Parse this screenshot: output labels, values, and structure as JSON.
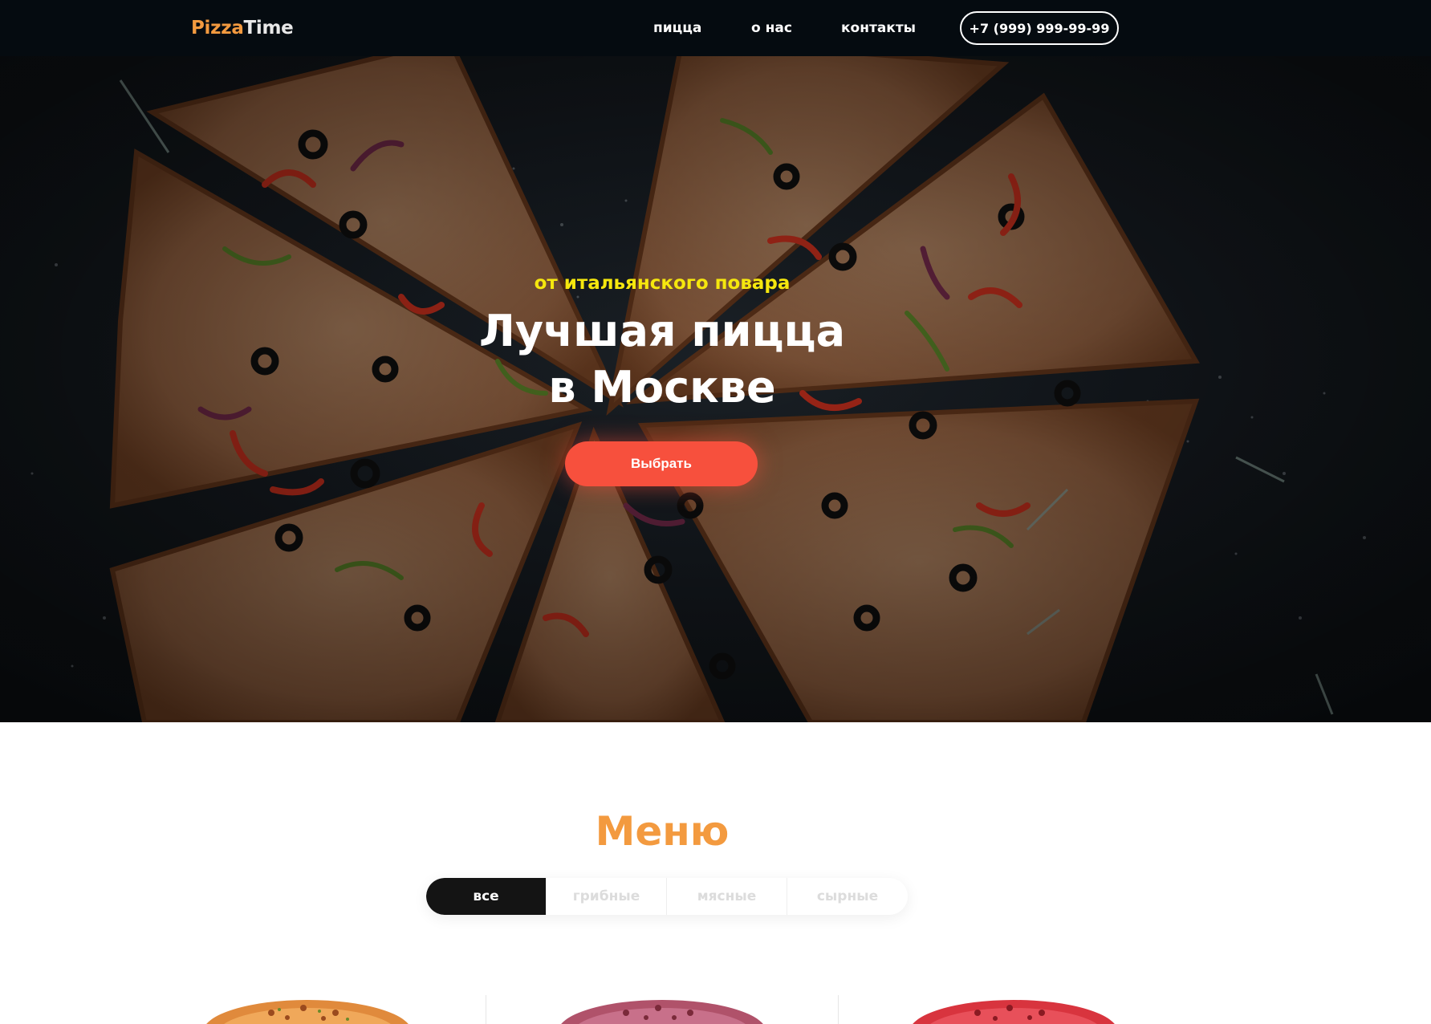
{
  "header": {
    "logo": {
      "part1": "Pizza",
      "part2": "Time"
    },
    "nav": [
      "пицца",
      "о нас",
      "контакты"
    ],
    "phone": "+7 (999) 999-99-99"
  },
  "hero": {
    "subtitle": "от итальянского повара",
    "title_line1": "Лучшая пицца",
    "title_line2": "в Москве",
    "button": "Выбрать"
  },
  "menu": {
    "title": "Меню",
    "tabs": [
      "все",
      "грибные",
      "мясные",
      "сырные"
    ],
    "active_tab": "все"
  },
  "colors": {
    "accent_orange": "#f39a3f",
    "accent_yellow": "#f5e70e",
    "cta_red": "#f7503d",
    "header_bg": "#050b10"
  }
}
